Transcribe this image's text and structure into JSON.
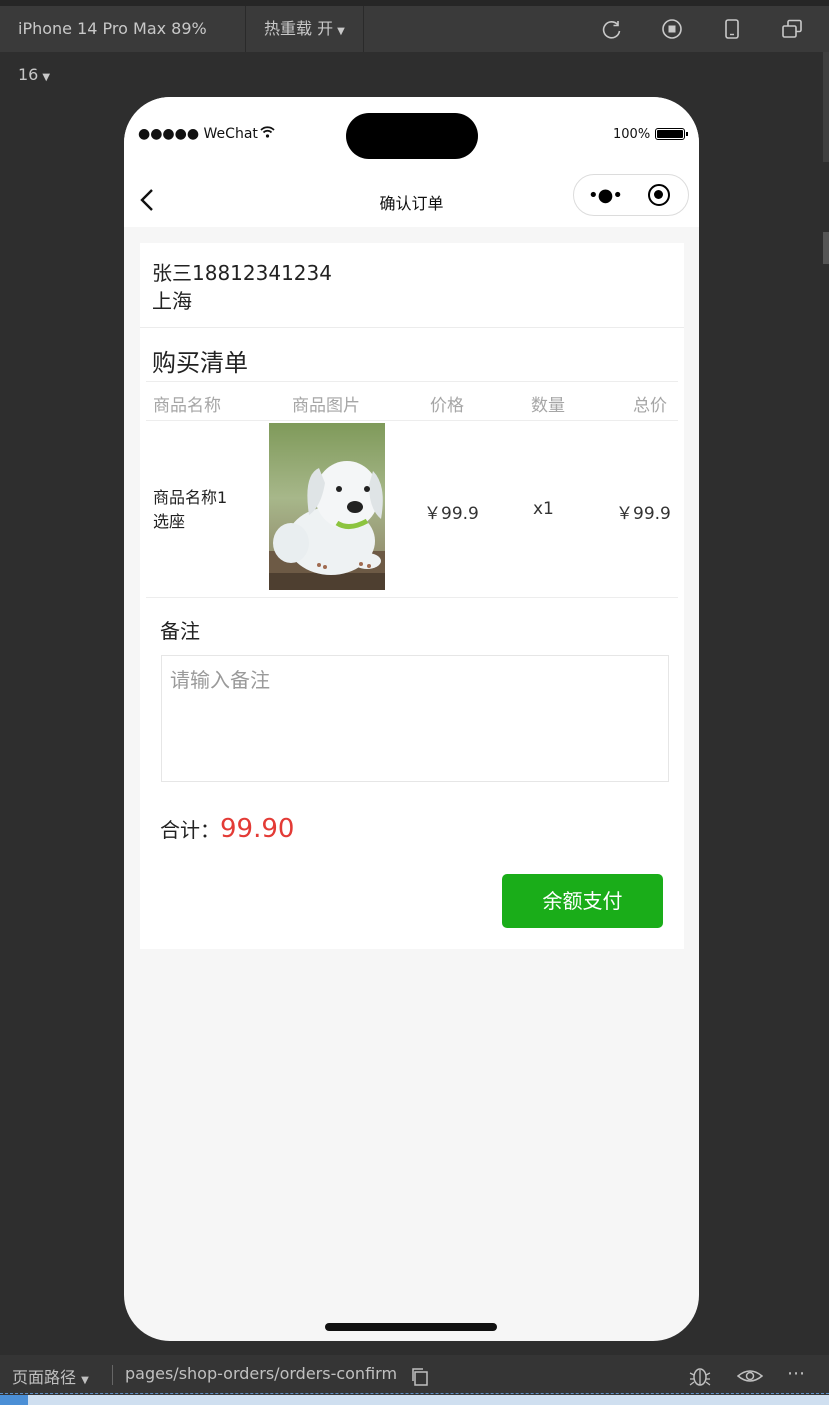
{
  "toolbar": {
    "device_selector": "iPhone 14 Pro Max 89% 16",
    "hot_reload": "热重载 开",
    "icons": [
      "refresh-icon",
      "stop-icon",
      "phone-icon",
      "window-icon"
    ]
  },
  "phone": {
    "status_bar": {
      "carrier": "●●●●● WeChat",
      "battery_percent": "100%"
    },
    "nav": {
      "title": "确认订单",
      "menu_icon": "more-dots-icon",
      "close_icon": "target-icon"
    },
    "address": {
      "contact": "张三18812341234",
      "city": "上海"
    },
    "order": {
      "section_title": "购买清单",
      "columns": [
        "商品名称",
        "商品图片",
        "价格",
        "数量",
        "总价"
      ],
      "items": [
        {
          "name_line1": "商品名称1",
          "name_line2": "选座",
          "image": "puppy-photo",
          "price": "￥99.9",
          "quantity": "x1",
          "total": "￥99.9"
        }
      ]
    },
    "remark": {
      "label": "备注",
      "placeholder": "请输入备注",
      "value": ""
    },
    "summary": {
      "label": "合计：",
      "amount": "99.90"
    },
    "pay_button": "余额支付",
    "colors": {
      "accent_green": "#1aad19",
      "price_red": "#e33b36"
    }
  },
  "bottom_bar": {
    "path_label": "页面路径",
    "path": "pages/shop-orders/orders-confirm"
  }
}
